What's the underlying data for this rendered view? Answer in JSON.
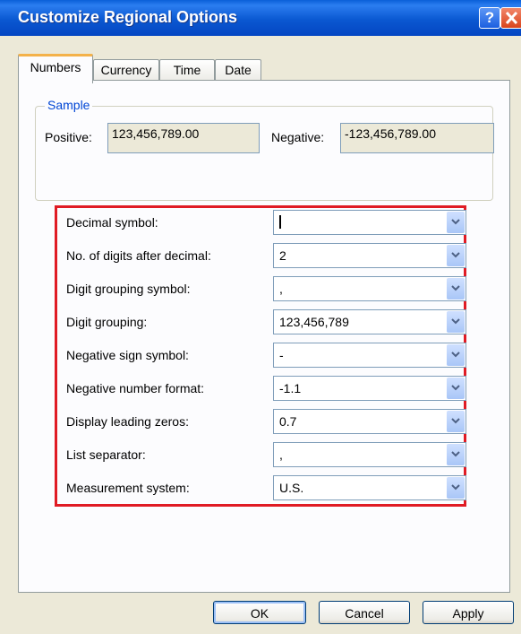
{
  "window": {
    "title": "Customize Regional Options"
  },
  "tabs": [
    "Numbers",
    "Currency",
    "Time",
    "Date"
  ],
  "sample": {
    "label": "Sample",
    "positive_label": "Positive:",
    "positive_value": "123,456,789.00",
    "negative_label": "Negative:",
    "negative_value": "-123,456,789.00"
  },
  "settings": [
    {
      "label": "Decimal symbol:",
      "value": ""
    },
    {
      "label": "No. of digits after decimal:",
      "value": "2"
    },
    {
      "label": "Digit grouping symbol:",
      "value": ","
    },
    {
      "label": "Digit grouping:",
      "value": "123,456,789"
    },
    {
      "label": "Negative sign symbol:",
      "value": "-"
    },
    {
      "label": "Negative number format:",
      "value": "-1.1"
    },
    {
      "label": "Display leading zeros:",
      "value": "0.7"
    },
    {
      "label": "List separator:",
      "value": ","
    },
    {
      "label": "Measurement system:",
      "value": "U.S."
    }
  ],
  "buttons": {
    "ok": "OK",
    "cancel": "Cancel",
    "apply": "Apply"
  },
  "icons": {
    "help": "question-mark",
    "close": "x-mark",
    "dropdown": "chevron-down"
  }
}
